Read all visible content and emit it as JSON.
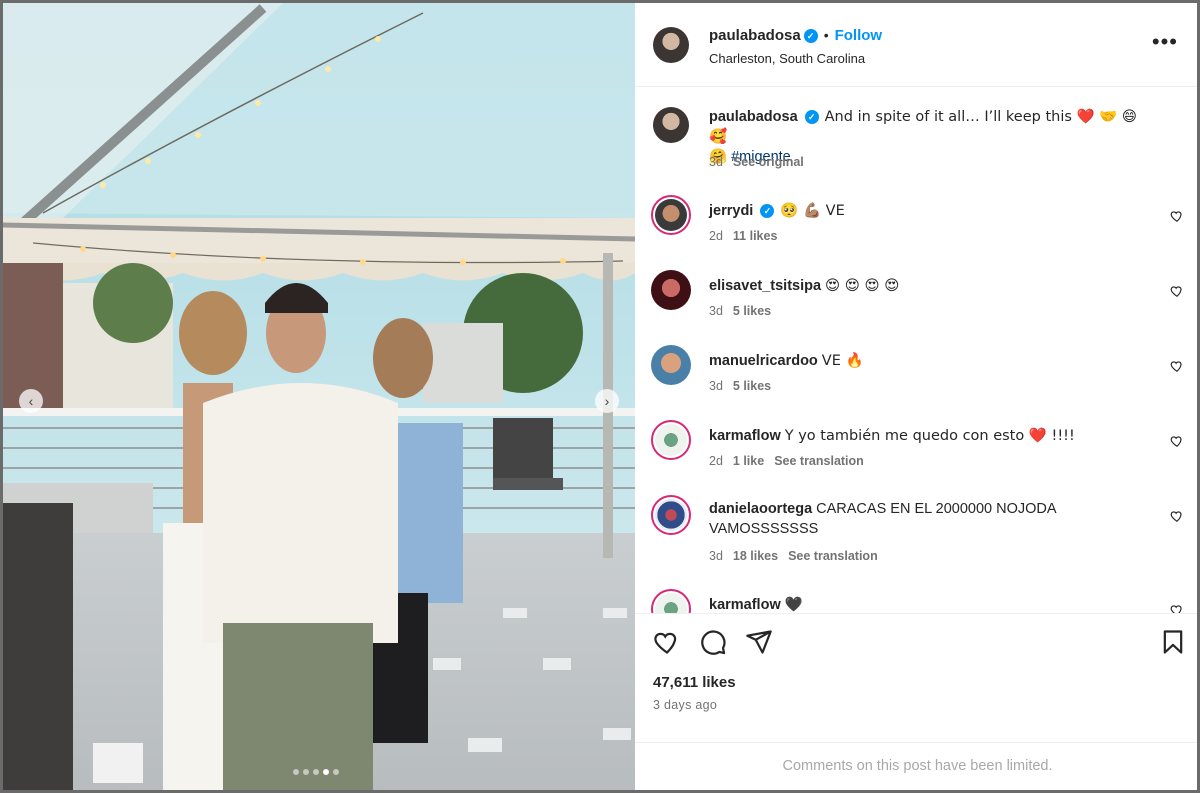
{
  "post": {
    "author": "paulabadosa",
    "follow_label": "Follow",
    "separator": "•",
    "location": "Charleston, South Carolina",
    "more_label": "•••"
  },
  "caption": {
    "username": "paulabadosa",
    "text": "And in spite of it all… I’ll keep this ❤️ 🤝 😄 🥰",
    "text_line2": "🤗",
    "hashtag": "#migente",
    "time": "3d",
    "see_original": "See original"
  },
  "comments": [
    {
      "username": "jerrydi",
      "text": "🥺 💪🏽 VE",
      "time": "2d",
      "likes": "11 likes",
      "translation": ""
    },
    {
      "username": "elisavet_tsitsipa",
      "text": "😍 😍 😍 😍",
      "time": "3d",
      "likes": "5 likes",
      "translation": ""
    },
    {
      "username": "manuelricardoo",
      "text": "VE 🔥",
      "time": "3d",
      "likes": "5 likes",
      "translation": ""
    },
    {
      "username": "karmaflow",
      "text": "Y yo también me quedo con esto ❤️ !!!!",
      "time": "2d",
      "likes": "1 like",
      "translation": "See translation"
    },
    {
      "username": "danielaoortega",
      "text": "CARACAS EN EL 2000000 NOJODA VAMOSSSSSSS",
      "time": "3d",
      "likes": "18 likes",
      "translation": "See translation"
    },
    {
      "username": "karmaflow",
      "text": "🖤",
      "time": "",
      "likes": "",
      "translation": ""
    }
  ],
  "footer": {
    "likes": "47,611 likes",
    "posted": "3 days ago",
    "limited_notice": "Comments on this post have been limited."
  },
  "carousel": {
    "slide_count": 5,
    "active_index": 3,
    "prev": "‹",
    "next": "›"
  },
  "colors": {
    "accent": "#0095f6",
    "verified": "#0095f6",
    "muted": "#737373",
    "story_ring": "#d62976"
  },
  "icons": [
    "heart-icon",
    "comment-icon",
    "share-icon",
    "bookmark-icon",
    "verified-icon",
    "more-icon"
  ]
}
